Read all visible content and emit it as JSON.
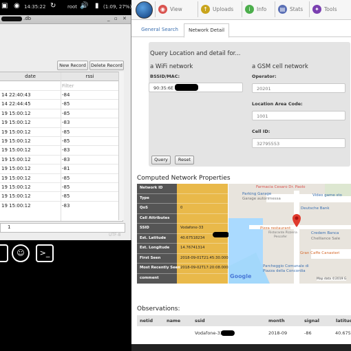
{
  "taskbar": {
    "time": "14:35:22",
    "user": "root",
    "battery": "(1:09, 27%)"
  },
  "db_window": {
    "title_suffix": ".db",
    "buttons": {
      "new_record": "New Record",
      "delete_record": "Delete Record"
    },
    "columns": {
      "date": "date",
      "rssi": "rssi"
    },
    "filter_placeholder": "Filter",
    "rows": [
      {
        "date": "14 22:40:43",
        "rssi": "-84"
      },
      {
        "date": "14 22:44:45",
        "rssi": "-85"
      },
      {
        "date": "19 15:00:12",
        "rssi": "-85"
      },
      {
        "date": "19 15:00:12",
        "rssi": "-83"
      },
      {
        "date": "19 15:00:12",
        "rssi": "-85"
      },
      {
        "date": "19 15:00:12",
        "rssi": "-85"
      },
      {
        "date": "19 15:00:12",
        "rssi": "-83"
      },
      {
        "date": "19 15:00:12",
        "rssi": "-83"
      },
      {
        "date": "19 15:00:12",
        "rssi": "-81"
      },
      {
        "date": "19 15:00:12",
        "rssi": "-85"
      },
      {
        "date": "19 15:00:12",
        "rssi": "-85"
      },
      {
        "date": "19 15:00:12",
        "rssi": "-85"
      },
      {
        "date": "19 15:00:12",
        "rssi": "-83"
      }
    ],
    "page_number": "1",
    "encoding": "UTF-8"
  },
  "nav": {
    "items": [
      {
        "label": "View",
        "color": "#d9534f"
      },
      {
        "label": "Uploads",
        "color": "#c9a41c"
      },
      {
        "label": "Info",
        "color": "#4cae4c"
      },
      {
        "label": "Stats",
        "color": "#5a6fb5"
      },
      {
        "label": "Tools",
        "color": "#7a3fb0"
      }
    ]
  },
  "tabs": {
    "general": "General Search",
    "network": "Network Detail"
  },
  "query": {
    "heading": "Query Location and detail for...",
    "wifi_heading": "a WiFi network",
    "gsm_heading": "a GSM cell network",
    "bssid_label": "BSSID/MAC:",
    "bssid_value": "90:35:6E",
    "operator_label": "Operator:",
    "operator_value": "20201",
    "lac_label": "Location Area Code:",
    "lac_value": "1001",
    "cellid_label": "Cell ID:",
    "cellid_value": "32795553",
    "query_button": "Query",
    "reset_button": "Reset"
  },
  "computed": {
    "title": "Computed Network Properties",
    "rows": [
      {
        "label": "Network ID",
        "value": ""
      },
      {
        "label": "Type",
        "value": ""
      },
      {
        "label": "QoS",
        "value": "0"
      },
      {
        "label": "Cell Attributes",
        "value": ""
      },
      {
        "label": "SSID",
        "value": "Vodafone-33"
      },
      {
        "label": "Est. Latitude",
        "value": "40.67518234"
      },
      {
        "label": "Est. Longitude",
        "value": "14.76741314"
      },
      {
        "label": "First Seen",
        "value": "2018-09-01T21:45:30.000Z"
      },
      {
        "label": "Most Recently Seen",
        "value": "2018-09-02T17:20:08.000Z"
      },
      {
        "label": "comment",
        "value": ""
      }
    ]
  },
  "map": {
    "labels": {
      "farmacia": "Farmacia Cesaro Dr. Paolo",
      "parking": "Parking Garage",
      "parking_sub": "Garage autorimessa",
      "video": "Video game sto",
      "deutsche": "Deutsche Bank",
      "pizza": "Pizza restaurant",
      "pizza_sub": "Ristorante Pizzeria",
      "pizza_sub2": "Pescofer",
      "credem": "Credem Banca",
      "credem_sub": "Chelliance Sale",
      "gran_caffe": "Gran Caffe Canasteri",
      "parcheggio": "Parcheggio Comunale di",
      "parcheggio2": "Piazza della Concordia",
      "google": "Google",
      "mapdata": "Map data ©2019 G"
    }
  },
  "observations": {
    "title": "Observations:",
    "columns": [
      "netid",
      "name",
      "ssid",
      "month",
      "signal",
      "latitude"
    ],
    "row": {
      "ssid": "Vodafone-33",
      "month": "2018-09",
      "signal": "-86",
      "latitude": "40.6751"
    }
  }
}
